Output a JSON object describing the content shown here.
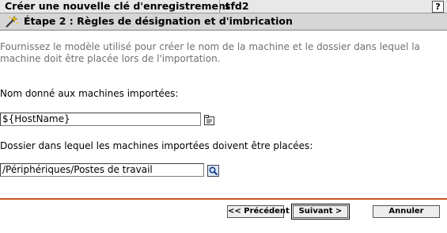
{
  "header": {
    "title": "Créer une nouvelle clé d'enregistrement",
    "server": "sfd2",
    "help_label": "?"
  },
  "step": {
    "title": "Étape 2 : Règles de désignation et d'imbrication",
    "icon": "magic-wand-icon"
  },
  "intro": "Fournissez le modèle utilisé pour créer le nom de la machine et le dossier dans lequel la machine doit être placée lors de l'importation.",
  "name_field": {
    "label": "Nom donné aux machines importées:",
    "value": "${HostName}",
    "icon": "variable-picker-icon"
  },
  "folder_field": {
    "label": "Dossier dans lequel les machines importées doivent être placées:",
    "value": "/Périphériques/Postes de travail",
    "icon": "browse-search-icon"
  },
  "buttons": {
    "previous": "<< Précédent",
    "next": "Suivant >",
    "cancel": "Annuler"
  },
  "colors": {
    "accent_divider": "#cc5522",
    "intro_text": "#707070"
  }
}
